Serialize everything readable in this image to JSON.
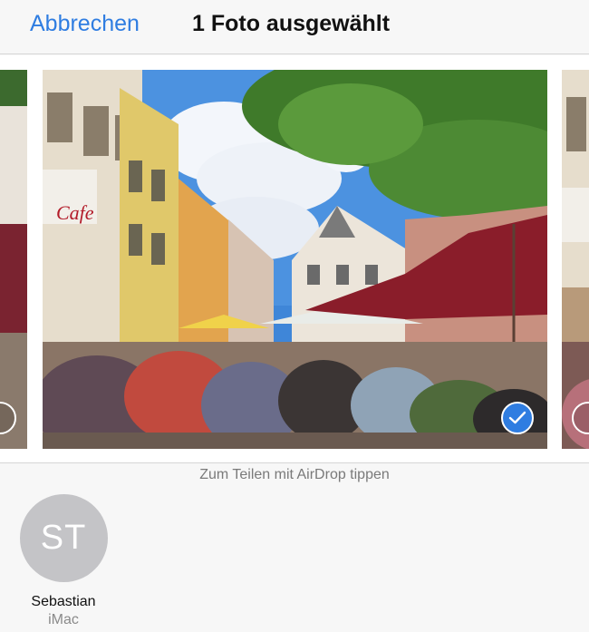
{
  "navbar": {
    "cancel_label": "Abbrechen",
    "title": "1 Foto ausgewählt"
  },
  "photos": {
    "main_selected": true,
    "accent_color": "#2f7de1"
  },
  "airdrop": {
    "hint": "Zum Teilen mit AirDrop tippen",
    "contacts": [
      {
        "initials": "ST",
        "name": "Sebastian",
        "device": "iMac"
      }
    ]
  }
}
